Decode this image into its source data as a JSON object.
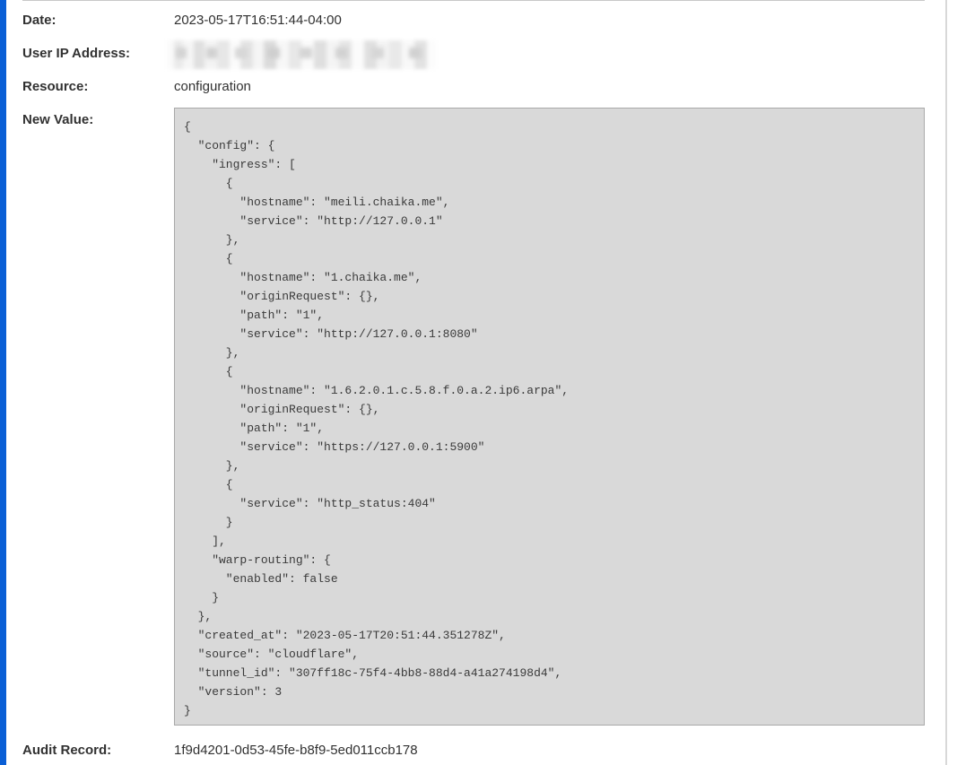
{
  "fields": {
    "date_label": "Date:",
    "date_value": "2023-05-17T16:51:44-04:00",
    "user_ip_label": "User IP Address:",
    "resource_label": "Resource:",
    "resource_value": "configuration",
    "new_value_label": "New Value:",
    "new_value_json": "{\n  \"config\": {\n    \"ingress\": [\n      {\n        \"hostname\": \"meili.chaika.me\",\n        \"service\": \"http://127.0.0.1\"\n      },\n      {\n        \"hostname\": \"1.chaika.me\",\n        \"originRequest\": {},\n        \"path\": \"1\",\n        \"service\": \"http://127.0.0.1:8080\"\n      },\n      {\n        \"hostname\": \"1.6.2.0.1.c.5.8.f.0.a.2.ip6.arpa\",\n        \"originRequest\": {},\n        \"path\": \"1\",\n        \"service\": \"https://127.0.0.1:5900\"\n      },\n      {\n        \"service\": \"http_status:404\"\n      }\n    ],\n    \"warp-routing\": {\n      \"enabled\": false\n    }\n  },\n  \"created_at\": \"2023-05-17T20:51:44.351278Z\",\n  \"source\": \"cloudflare\",\n  \"tunnel_id\": \"307ff18c-75f4-4bb8-88d4-a41a274198d4\",\n  \"version\": 3\n}",
    "audit_record_label": "Audit Record:",
    "audit_record_value": "1f9d4201-0d53-45fe-b8f9-5ed011ccb178"
  },
  "colors": {
    "accent": "#0a5fd6",
    "text": "#313131",
    "json_background": "#d9d9d9",
    "json_border": "#a9a9a9"
  }
}
